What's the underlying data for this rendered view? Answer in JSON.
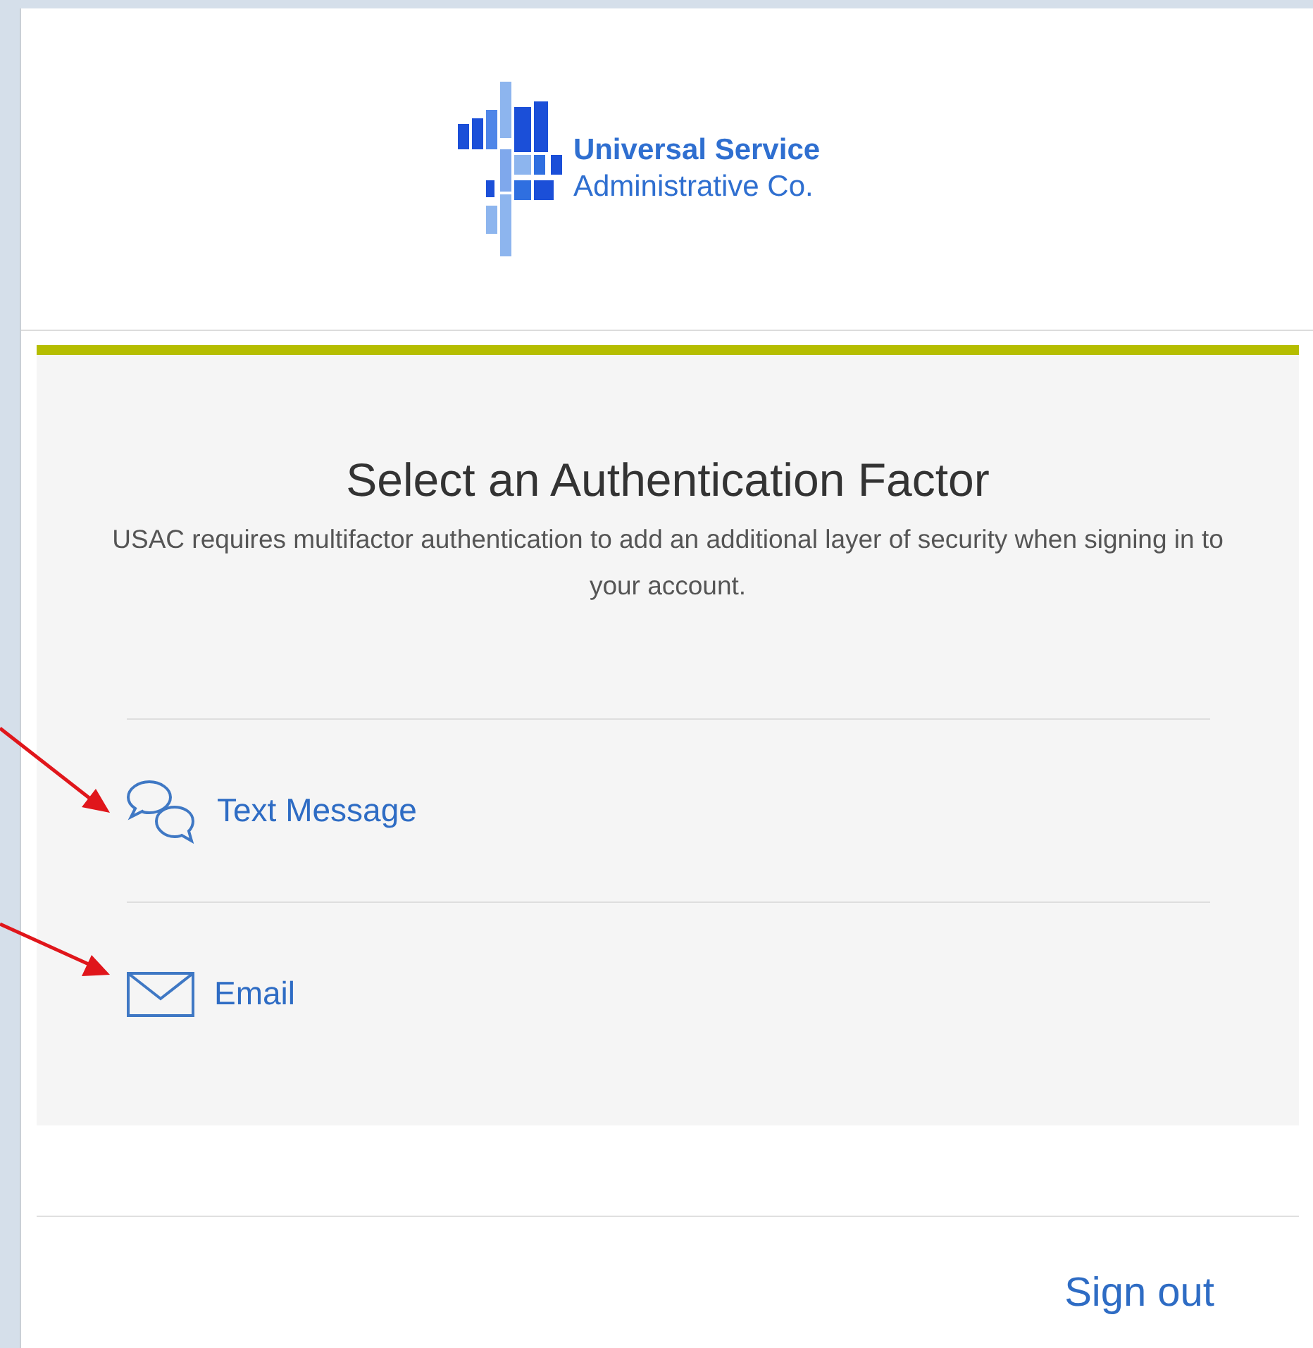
{
  "logo": {
    "line_1": "Universal Service",
    "line_2": "Administrative Co."
  },
  "card": {
    "title": "Select an Authentication Factor",
    "description": "USAC requires multifactor authentication to add an additional layer of security when signing in to your account."
  },
  "factors": [
    {
      "kind": "sms",
      "label": "Text Message"
    },
    {
      "kind": "email",
      "label": "Email"
    }
  ],
  "footer": {
    "link": "Sign out"
  }
}
